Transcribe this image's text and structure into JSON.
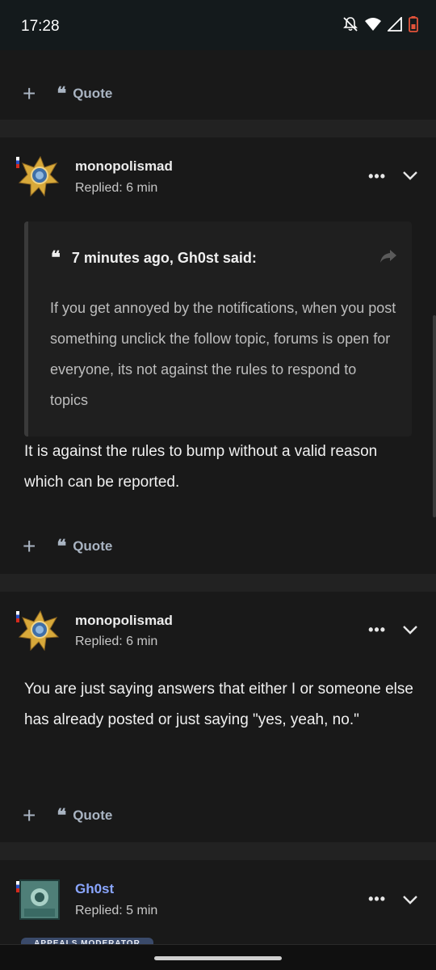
{
  "status_bar": {
    "time": "17:28"
  },
  "actions": {
    "plus": "+",
    "quote_label": "Quote",
    "quote_glyph": "❝"
  },
  "posts": [
    {
      "author": "monopolismad",
      "replied": "Replied: 6 min",
      "quote": {
        "header": "7 minutes ago, Gh0st said:",
        "text": "If you get annoyed by the notifications, when you post something unclick the follow topic, forums is open for everyone, its not against the rules to respond to topics"
      },
      "body": "It is against the rules to bump without a valid reason which can be reported."
    },
    {
      "author": "monopolismad",
      "replied": "Replied: 6 min",
      "body": "You are just saying answers that either I or someone else has already posted or just saying \"yes, yeah, no.\""
    },
    {
      "author": "Gh0st",
      "replied": "Replied: 5 min",
      "badge": "APPEALS MODERATOR"
    }
  ],
  "colors": {
    "background": "#141414",
    "post_bg": "#191919",
    "divider": "#222222",
    "action": "#a9b4c2",
    "moderator_name": "#8aa6ff"
  }
}
